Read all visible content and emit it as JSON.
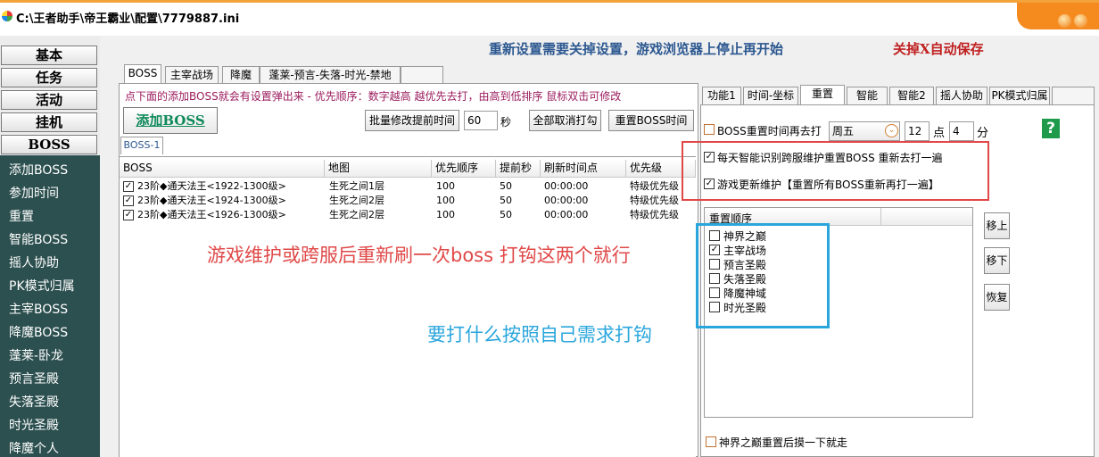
{
  "window": {
    "title": "C:\\王者助手\\帝王霸业\\配置\\7779887.ini"
  },
  "sidebar": {
    "buttons": [
      "基本",
      "任务",
      "活动",
      "挂机",
      "BOSS"
    ],
    "items": [
      "添加BOSS",
      "参加时间",
      "重置",
      "智能BOSS",
      "摇人协助",
      "PK模式归属",
      "主宰BOSS",
      "降魔BOSS",
      "蓬莱-卧龙",
      "预言圣殿",
      "失落圣殿",
      "时光圣殿",
      "降魔个人"
    ]
  },
  "notice": {
    "text": "重新设置需要关掉设置，游戏浏览器上停止再开始",
    "emphasis": "关掉X自动保存"
  },
  "left": {
    "tabs": [
      "BOSS",
      "主宰战场",
      "降魔",
      "蓬莱-预言-失落-时光-禁地"
    ],
    "hint": "点下面的添加BOSS就会有设置弹出来  - 优先顺序：数字越高 越优先去打，由高到低排序  鼠标双击可修改",
    "add_boss": "添加BOSS",
    "batch_label": "批量修改提前时间",
    "batch_value": "60",
    "batch_unit": "秒",
    "uncheck_all": "全部取消打勾",
    "reset_time": "重置BOSS时间",
    "subtab": "BOSS-1",
    "columns": [
      "BOSS",
      "地图",
      "优先顺序",
      "提前秒",
      "刷新时间点",
      "优先级"
    ],
    "rows": [
      {
        "boss": "23阶◆通天法王<1922-1300级>",
        "map": "生死之间1层",
        "order": "100",
        "ahead": "50",
        "time": "00:00:00",
        "level": "特级优先级"
      },
      {
        "boss": "23阶◆通天法王<1924-1300级>",
        "map": "生死之间2层",
        "order": "100",
        "ahead": "50",
        "time": "00:00:00",
        "level": "特级优先级"
      },
      {
        "boss": "23阶◆通天法王<1926-1300级>",
        "map": "生死之间2层",
        "order": "100",
        "ahead": "50",
        "time": "00:00:00",
        "level": "特级优先级"
      }
    ]
  },
  "annotations": {
    "red": "游戏维护或跨服后重新刷一次boss 打钩这两个就行",
    "blue": "要打什么按照自己需求打钩"
  },
  "right": {
    "tabs": [
      "功能1",
      "时间-坐标",
      "重置",
      "智能",
      "智能2",
      "摇人协助",
      "PK模式归属"
    ],
    "reset_again_label": "BOSS重置时间再去打",
    "weekday": "周五",
    "hour": "12",
    "hour_unit": "点",
    "minute": "4",
    "minute_unit": "分",
    "opt_daily": "每天智能识别跨服维护重置BOSS 重新去打一遍",
    "opt_update": "游戏更新维护【重置所有BOSS重新再打一遍】",
    "reset_order_header": "重置顺序",
    "reset_list": [
      {
        "label": "神界之巅",
        "checked": false
      },
      {
        "label": "主宰战场",
        "checked": true
      },
      {
        "label": "预言圣殿",
        "checked": false
      },
      {
        "label": "失落圣殿",
        "checked": false
      },
      {
        "label": "降魔神域",
        "checked": false
      },
      {
        "label": "时光圣殿",
        "checked": false
      }
    ],
    "move_up": "移上",
    "move_down": "移下",
    "restore": "恢复",
    "bottom_option": "神界之巅重置后摸一下就走",
    "help": "?"
  },
  "colors": {
    "annotation_red": "#e04848",
    "annotation_blue": "#2aa6dc",
    "sidebar_bg": "#2c4f4f"
  }
}
